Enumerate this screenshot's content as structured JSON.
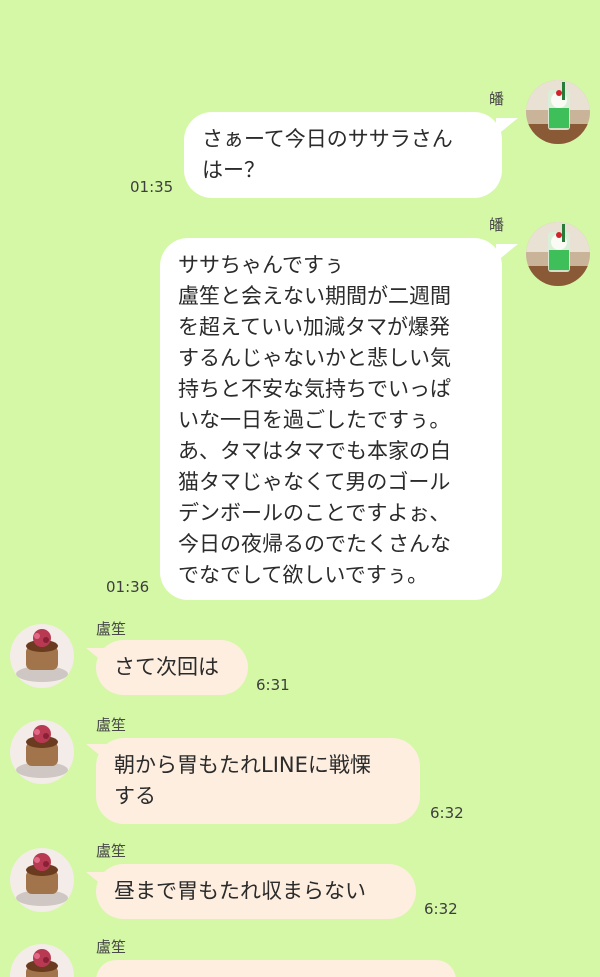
{
  "messages": [
    {
      "id": "m1",
      "direction": "outgoing",
      "sender": "皤",
      "text": "さぁーて今日のササラさん\nはー？",
      "time": "01:35",
      "avatar_icon": "melon-soda-avatar-icon"
    },
    {
      "id": "m2",
      "direction": "outgoing",
      "sender": "皤",
      "text": "ササちゃんですぅ\n盧笙と会えない期間が二週間\nを超えていい加減タマが爆発\nするんじゃないかと悲しい気\n持ちと不安な気持ちでいっぱ\nいな一日を過ごしたですぅ。\nあ、タマはタマでも本家の白\n猫タマじゃなくて男のゴール\nデンボールのことですよぉ、\n今日の夜帰るのでたくさんな\nでなでして欲しいですぅ。",
      "time": "01:36",
      "avatar_icon": "melon-soda-avatar-icon"
    },
    {
      "id": "m3",
      "direction": "incoming",
      "sender": "盧笙",
      "text": "さて次回は",
      "time": "6:31",
      "avatar_icon": "pudding-avatar-icon"
    },
    {
      "id": "m4",
      "direction": "incoming",
      "sender": "盧笙",
      "text": "朝から胃もたれLINEに戦慄\nする",
      "time": "6:32",
      "avatar_icon": "pudding-avatar-icon"
    },
    {
      "id": "m5",
      "direction": "incoming",
      "sender": "盧笙",
      "text": "昼まで胃もたれ収まらない",
      "time": "6:32",
      "avatar_icon": "pudding-avatar-icon"
    },
    {
      "id": "m6",
      "direction": "incoming",
      "sender": "盧笙",
      "text": "",
      "time": "",
      "avatar_icon": "pudding-avatar-icon"
    }
  ],
  "colors": {
    "background": "#d4f8a6",
    "outgoing_bubble": "#ffffff",
    "incoming_bubble": "#fdeee0"
  }
}
